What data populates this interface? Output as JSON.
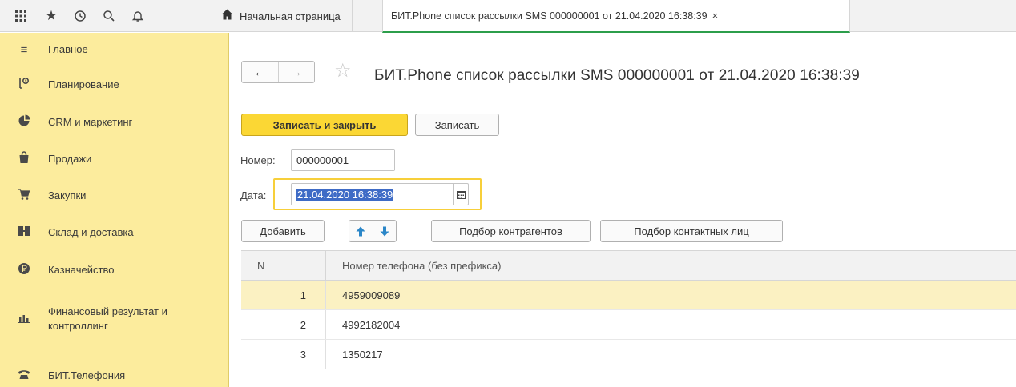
{
  "topbar": {
    "icons": [
      "apps-grid-icon",
      "star-icon",
      "history-icon",
      "search-icon",
      "bell-icon"
    ],
    "home_tab_label": "Начальная страница",
    "doc_tab_label": "БИТ.Phone список рассылки SMS 000000001 от 21.04.2020 16:38:39",
    "close_glyph": "×"
  },
  "sidebar": {
    "items": [
      {
        "label": "Главное",
        "icon": "menu-lines-icon"
      },
      {
        "label": "Планирование",
        "icon": "planning-icon"
      },
      {
        "label": "CRM и маркетинг",
        "icon": "pie-chart-icon"
      },
      {
        "label": "Продажи",
        "icon": "shopping-bag-icon"
      },
      {
        "label": "Закупки",
        "icon": "cart-icon"
      },
      {
        "label": "Склад и доставка",
        "icon": "warehouse-icon"
      },
      {
        "label": "Казначейство",
        "icon": "ruble-coin-icon"
      },
      {
        "label": "Финансовый результат и контроллинг",
        "icon": "bar-chart-icon"
      },
      {
        "label": "БИТ.Телефония",
        "icon": "telephone-icon"
      }
    ]
  },
  "document": {
    "title": "БИТ.Phone список рассылки SMS 000000001 от 21.04.2020 16:38:39",
    "buttons": {
      "save_close": "Записать и закрыть",
      "save": "Записать",
      "add": "Добавить",
      "pick_counterparties": "Подбор контрагентов",
      "pick_contacts": "Подбор контактных лиц"
    },
    "number_label": "Номер:",
    "number_value": "000000001",
    "date_label": "Дата:",
    "date_value": "21.04.2020 16:38:39"
  },
  "table": {
    "columns": [
      "N",
      "Номер телефона (без префикса)"
    ],
    "rows": [
      {
        "n": "1",
        "phone": "4959009089"
      },
      {
        "n": "2",
        "phone": "4992182004"
      },
      {
        "n": "3",
        "phone": "1350217"
      }
    ],
    "selected_row": 1
  },
  "colors": {
    "sidebar_bg": "#fcec9d",
    "primary_button": "#fbd734",
    "active_tab_underline": "#2c9e4b",
    "selection": "#3e6bc6",
    "selected_row_bg": "#fbf1c2"
  }
}
